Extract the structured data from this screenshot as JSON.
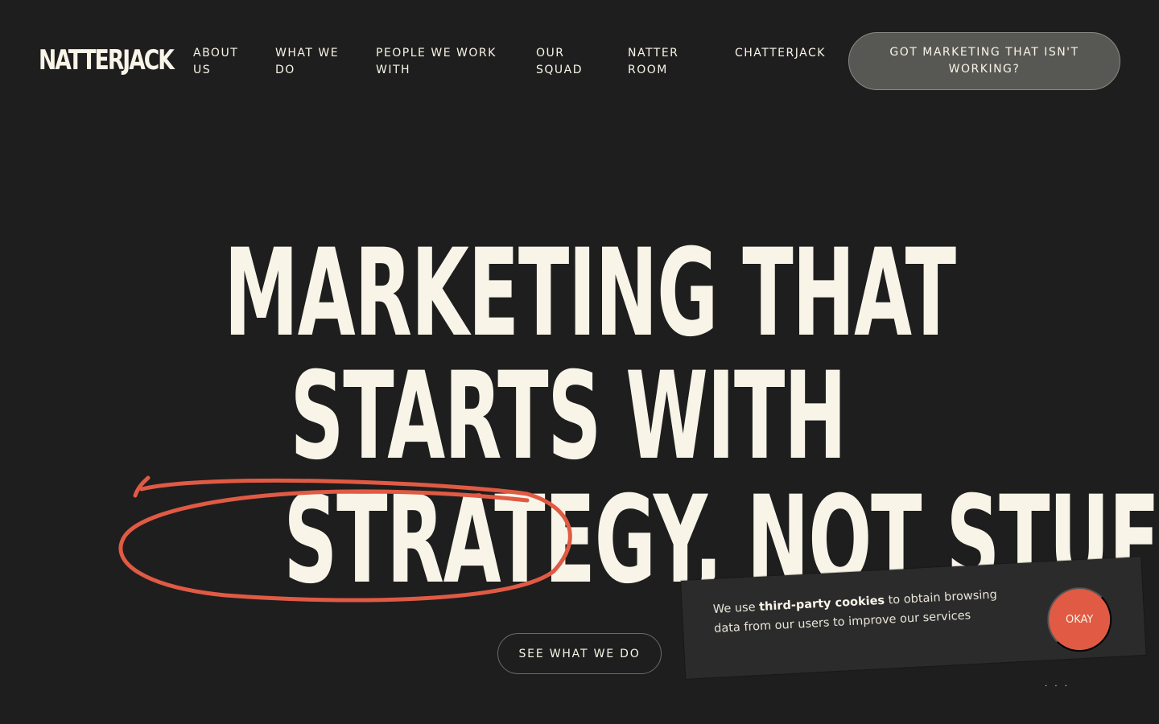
{
  "brand": {
    "logo": "NATTERJACK"
  },
  "nav": {
    "about": "ABOUT US",
    "what": "WHAT WE DO",
    "people": "PEOPLE WE WORK WITH",
    "squad": "OUR SQUAD",
    "natter": "NATTER ROOM",
    "chatter": "CHATTERJACK"
  },
  "header_cta": "GOT MARKETING THAT ISN'T WORKING?",
  "hero": {
    "line1": "MARKETING THAT",
    "line2": "STARTS WITH",
    "line3": "STRATEGY, NOT STUFF",
    "button": "SEE WHAT WE DO"
  },
  "cookie": {
    "prefix": "We use ",
    "highlight": "third-party cookies",
    "suffix": " to obtain browsing data from our users to improve our services",
    "button": "OKAY"
  },
  "colors": {
    "background": "#1e1e1e",
    "cream": "#f8f4e8",
    "accent": "#e05a44",
    "cta_bg": "#575753"
  }
}
